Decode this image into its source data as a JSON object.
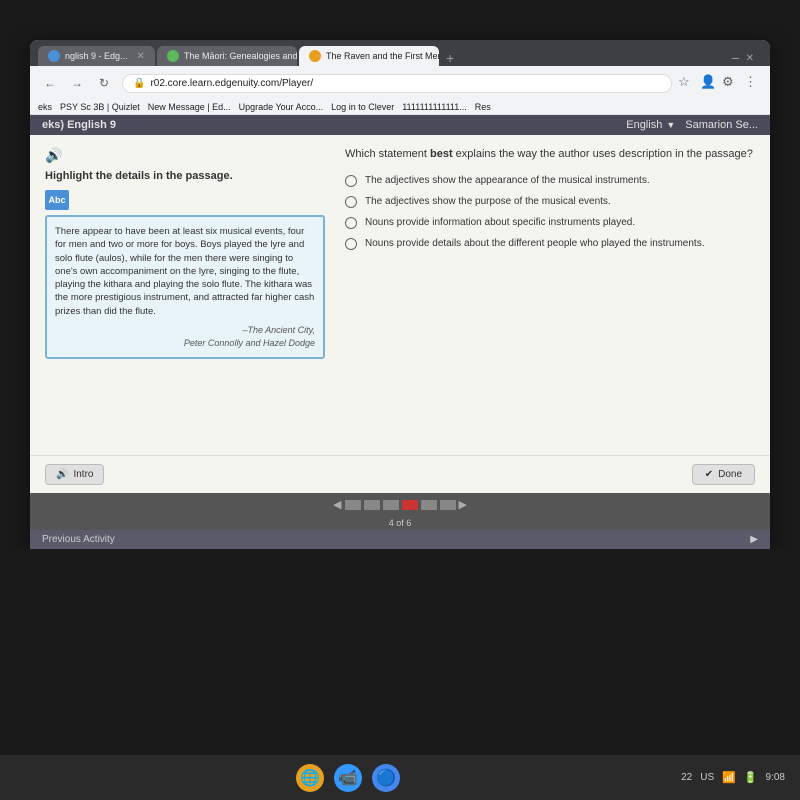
{
  "browser": {
    "tabs": [
      {
        "id": "tab1",
        "label": "nglish 9 - Edg...",
        "active": false,
        "color": "#4a90d9"
      },
      {
        "id": "tab2",
        "label": "The Māori: Genealogies and Ori...",
        "active": false,
        "color": "#5cb85c"
      },
      {
        "id": "tab3",
        "label": "The Raven and the First Men: Th...",
        "active": true,
        "color": "#e8a020"
      },
      {
        "id": "tab4",
        "label": "+",
        "active": false
      }
    ],
    "address": "r02.core.learn.edgenuity.com/Player/",
    "bookmarks": [
      {
        "label": "eks"
      },
      {
        "label": "PSY Sc 3B | Quizlet"
      },
      {
        "label": "New Message | Ed..."
      },
      {
        "label": "Upgrade Your Acco..."
      },
      {
        "label": "Log in to Clever"
      },
      {
        "label": "1111111111111..."
      },
      {
        "label": "Res"
      }
    ]
  },
  "app": {
    "header": {
      "title": "eks) English 9",
      "language_label": "English",
      "user": "Samarion Se..."
    },
    "activity": {
      "left_instruction": "Highlight the details in the passage.",
      "passage_text": "There appear to have been at least six musical events, four for men and two or more for boys. Boys played the lyre and solo flute (aulos), while for the men there were singing to one's own accompaniment on the lyre, singing to the flute, playing the kithara and playing the solo flute. The kithara was the more prestigious instrument, and attracted far higher cash prizes than did the flute.",
      "passage_source_line1": "–The Ancient City,",
      "passage_source_line2": "Peter Connolly and Hazel Dodge",
      "question_text": "Which statement best explains the way the author uses description in the passage?",
      "question_bold": "best",
      "answers": [
        {
          "id": "a",
          "text": "The adjectives show the appearance of the musical instruments."
        },
        {
          "id": "b",
          "text": "The adjectives show the purpose of the musical events."
        },
        {
          "id": "c",
          "text": "Nouns provide information about specific instruments played."
        },
        {
          "id": "d",
          "text": "Nouns provide details about the different people who played the instruments."
        }
      ],
      "intro_button": "Intro",
      "done_button": "Done",
      "progress": {
        "current": 4,
        "total": 6,
        "label": "4 of 6",
        "dots": [
          false,
          false,
          false,
          true,
          false,
          false
        ]
      }
    },
    "footer": {
      "previous_label": "Previous Activity",
      "next_arrow": "▶"
    }
  },
  "taskbar": {
    "left_label": "",
    "icons": [
      "🌐",
      "📹",
      "🔵"
    ],
    "right": {
      "number": "22",
      "locale": "US",
      "time": "9:08"
    }
  }
}
